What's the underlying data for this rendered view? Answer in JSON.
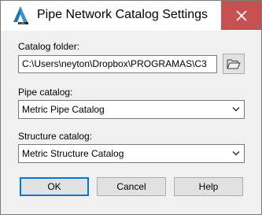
{
  "window": {
    "title": "Pipe Network Catalog Settings",
    "accent_color": "#c75050"
  },
  "catalog_folder": {
    "label": "Catalog folder:",
    "value": "C:\\Users\\neyton\\Dropbox\\PROGRAMAS\\C3"
  },
  "pipe_catalog": {
    "label": "Pipe catalog:",
    "selected": "Metric Pipe Catalog"
  },
  "structure_catalog": {
    "label": "Structure catalog:",
    "selected": "Metric Structure Catalog"
  },
  "buttons": {
    "ok": "OK",
    "cancel": "Cancel",
    "help": "Help"
  },
  "icons": {
    "app": "autocad-civil-icon",
    "close": "close-icon",
    "browse": "folder-open-icon",
    "dropdown": "chevron-down-icon"
  }
}
